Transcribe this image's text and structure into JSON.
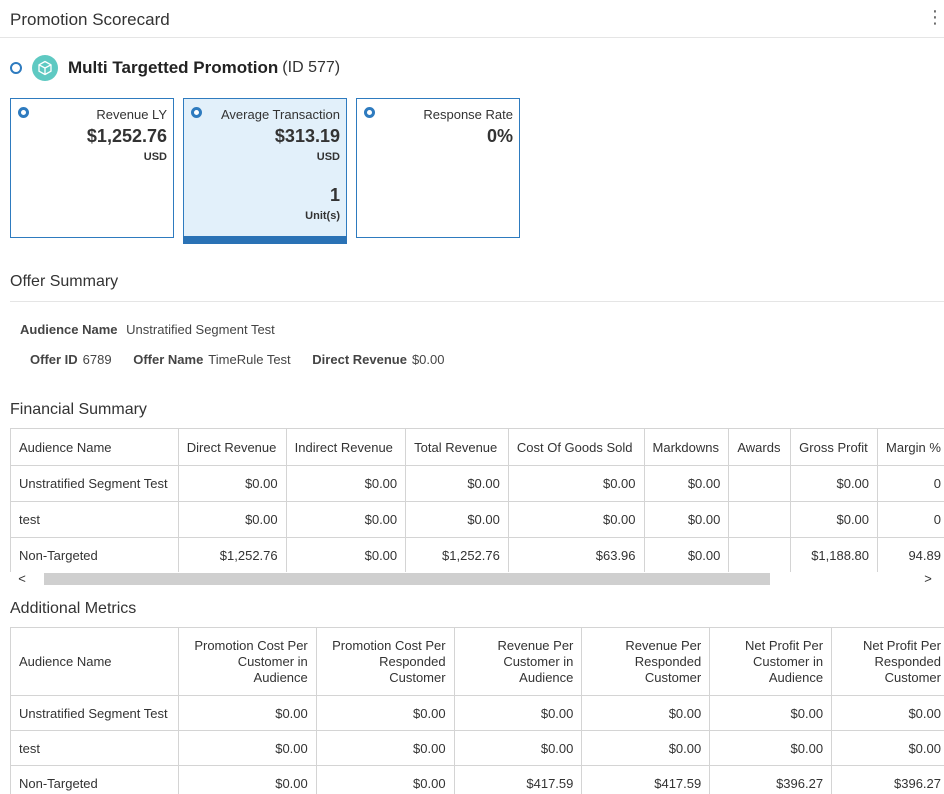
{
  "header": {
    "title": "Promotion Scorecard"
  },
  "promotion": {
    "name": "Multi Targetted Promotion",
    "id_text": "(ID 577)"
  },
  "tiles": [
    {
      "label": "Revenue LY",
      "value": "$1,252.76",
      "unit": "USD"
    },
    {
      "label": "Average Transaction",
      "value": "$313.19",
      "unit": "USD",
      "count": "1",
      "count_unit": "Unit(s)"
    },
    {
      "label": "Response Rate",
      "value": "0%"
    }
  ],
  "offer_summary": {
    "title": "Offer Summary",
    "audience_label": "Audience Name",
    "audience_value": "Unstratified Segment Test",
    "offer_id_label": "Offer ID",
    "offer_id_value": "6789",
    "offer_name_label": "Offer Name",
    "offer_name_value": "TimeRule Test",
    "direct_revenue_label": "Direct Revenue",
    "direct_revenue_value": "$0.00"
  },
  "financial": {
    "title": "Financial Summary",
    "columns": [
      "Audience Name",
      "Direct Revenue",
      "Indirect Revenue",
      "Total Revenue",
      "Cost Of Goods Sold",
      "Markdowns",
      "Awards",
      "Gross Profit",
      "Margin %"
    ],
    "rows": [
      [
        "Unstratified Segment Test",
        "$0.00",
        "$0.00",
        "$0.00",
        "$0.00",
        "$0.00",
        "",
        "$0.00",
        "0"
      ],
      [
        "test",
        "$0.00",
        "$0.00",
        "$0.00",
        "$0.00",
        "$0.00",
        "",
        "$0.00",
        "0"
      ],
      [
        "Non-Targeted",
        "$1,252.76",
        "$0.00",
        "$1,252.76",
        "$63.96",
        "$0.00",
        "",
        "$1,188.80",
        "94.89"
      ]
    ]
  },
  "scrollbar": {
    "left_arrow": "<",
    "right_arrow": ">"
  },
  "additional": {
    "title": "Additional Metrics",
    "columns": [
      "Audience Name",
      "Promotion Cost Per Customer in Audience",
      "Promotion Cost Per Responded Customer",
      "Revenue Per Customer in Audience",
      "Revenue Per Responded Customer",
      "Net Profit Per Customer in Audience",
      "Net Profit Per Responded Customer"
    ],
    "rows": [
      [
        "Unstratified Segment Test",
        "$0.00",
        "$0.00",
        "$0.00",
        "$0.00",
        "$0.00",
        "$0.00"
      ],
      [
        "test",
        "$0.00",
        "$0.00",
        "$0.00",
        "$0.00",
        "$0.00",
        "$0.00"
      ],
      [
        "Non-Targeted",
        "$0.00",
        "$0.00",
        "$417.59",
        "$417.59",
        "$396.27",
        "$396.27"
      ]
    ]
  },
  "colors": {
    "accent": "#2e7bbf",
    "selected_tile_bg": "#e2f0fa",
    "promo_icon": "#5ec9c2"
  }
}
